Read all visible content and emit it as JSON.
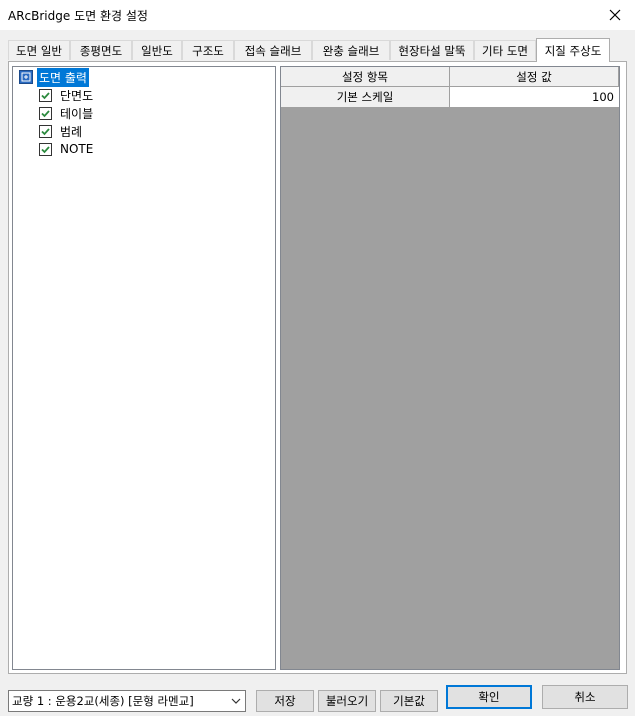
{
  "window": {
    "title": "ARcBridge 도면 환경 설정"
  },
  "tabs": [
    {
      "label": "도면 일반"
    },
    {
      "label": "종평면도"
    },
    {
      "label": "일반도"
    },
    {
      "label": "구조도"
    },
    {
      "label": "접속 슬래브"
    },
    {
      "label": "완충 슬래브"
    },
    {
      "label": "현장타설 말뚝"
    },
    {
      "label": "기타 도면"
    },
    {
      "label": "지질 주상도"
    }
  ],
  "tree": {
    "root": {
      "label": "도면 출력"
    },
    "items": [
      {
        "label": "단면도",
        "checked": true
      },
      {
        "label": "테이블",
        "checked": true
      },
      {
        "label": "범례",
        "checked": true
      },
      {
        "label": "NOTE",
        "checked": true
      }
    ]
  },
  "grid": {
    "headers": [
      "설정 항목",
      "설정 값"
    ],
    "rows": [
      {
        "key": "기본 스케일",
        "value": "100"
      }
    ]
  },
  "footer": {
    "bridge_select": "교량 1 : 운용2교(세종) [문형 라멘교]",
    "save": "저장",
    "load": "불러오기",
    "default": "기본값",
    "ok": "확인",
    "cancel": "취소"
  },
  "colors": {
    "selection": "#0078d7",
    "grid_background": "#a0a0a0",
    "checkbox_green": "#2b8a3e"
  }
}
